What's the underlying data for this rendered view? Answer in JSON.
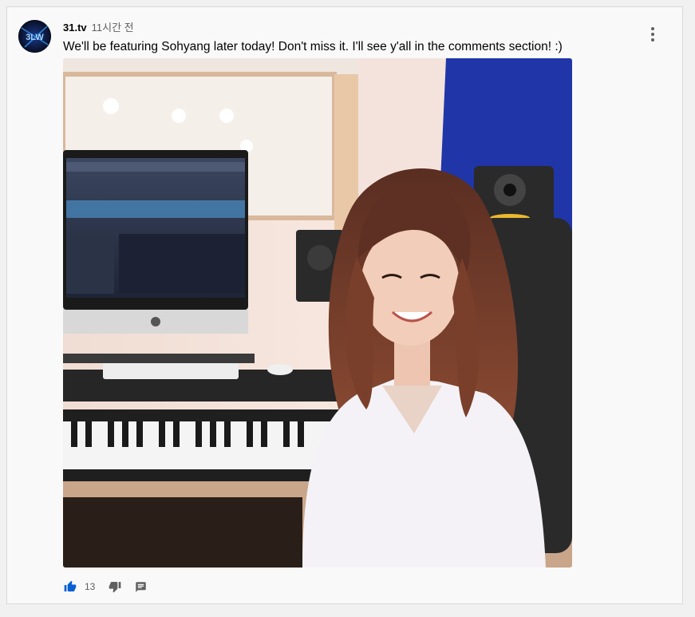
{
  "comment": {
    "author": "31.tv",
    "time": "11시간 전",
    "text": "We'll be featuring Sohyang later today! Don't miss it. I'll see y'all in the comments section! :)",
    "likes": "13",
    "avatar_text": "3LW"
  },
  "icons": {
    "like": "thumb-up-icon",
    "dislike": "thumb-down-icon",
    "reply": "reply-icon",
    "menu": "more-vert-icon"
  },
  "colors": {
    "like_blue": "#065fd4",
    "text": "#030303",
    "secondary": "#606060"
  }
}
